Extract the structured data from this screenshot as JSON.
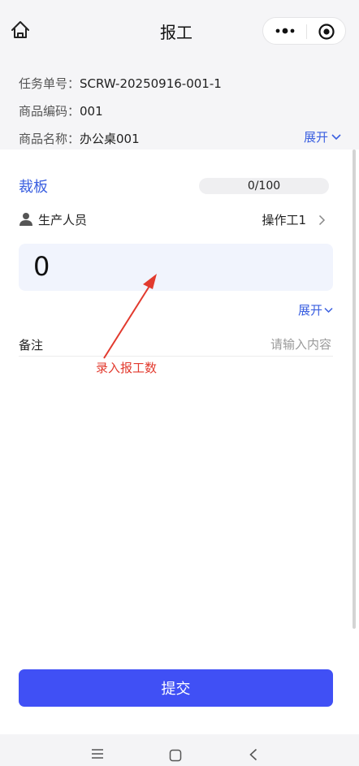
{
  "header": {
    "title": "报工",
    "icons": [
      "home-icon",
      "more-dots-icon",
      "target-circle-icon"
    ]
  },
  "info": {
    "rows": [
      {
        "label": "任务单号：",
        "value": "SCRW-20250916-001-1"
      },
      {
        "label": "商品编码：",
        "value": "001"
      },
      {
        "label": "商品名称：",
        "value": "办公桌001"
      }
    ],
    "expand_label": "展开"
  },
  "card": {
    "process_name": "裁板",
    "progress_text": "0/100",
    "progress_fraction": 0,
    "worker_label": "生产人员",
    "worker_value": "操作工1",
    "quantity_value": "0",
    "expand_label": "展开",
    "remark_label": "备注",
    "remark_placeholder": "请输入内容"
  },
  "annotation": {
    "text": "录入报工数",
    "color": "#e23a2e"
  },
  "submit_label": "提交",
  "colors": {
    "accent": "#3a5fe0",
    "button": "#4050f5",
    "annotation": "#e23a2e"
  }
}
